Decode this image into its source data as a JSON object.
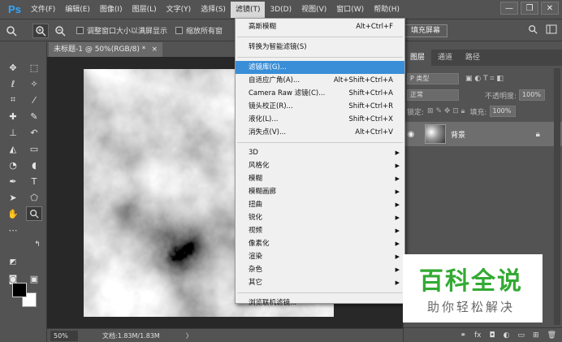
{
  "app": {
    "logo": "Ps"
  },
  "menubar": {
    "items": [
      "文件(F)",
      "编辑(E)",
      "图像(I)",
      "图层(L)",
      "文字(Y)",
      "选择(S)",
      "滤镜(T)",
      "3D(D)",
      "视图(V)",
      "窗口(W)",
      "帮助(H)"
    ],
    "active_index": 6
  },
  "window_controls": {
    "minimize": "—",
    "restore": "❐",
    "close": "✕"
  },
  "options_bar": {
    "checkbox1_label": "调整窗口大小以满屏显示",
    "checkbox2_label": "缩放所有窗",
    "fill_screen_label": "填充屏幕"
  },
  "document_tab": {
    "title": "未标题-1 @ 50%(RGB/8) *",
    "close": "×"
  },
  "status_bar": {
    "zoom": "50%",
    "doc_info": "文档:1.83M/1.83M",
    "arrow": "〉"
  },
  "filter_menu": {
    "items": [
      {
        "label": "高斯模糊",
        "shortcut": "Alt+Ctrl+F",
        "submenu": false,
        "highlight": false,
        "sep_after": true
      },
      {
        "label": "转换为智能滤镜(S)",
        "shortcut": "",
        "submenu": false,
        "highlight": false,
        "sep_after": true
      },
      {
        "label": "滤镜库(G)...",
        "shortcut": "",
        "submenu": false,
        "highlight": true,
        "sep_after": false
      },
      {
        "label": "自适应广角(A)...",
        "shortcut": "Alt+Shift+Ctrl+A",
        "submenu": false,
        "highlight": false,
        "sep_after": false
      },
      {
        "label": "Camera Raw 滤镜(C)...",
        "shortcut": "Shift+Ctrl+A",
        "submenu": false,
        "highlight": false,
        "sep_after": false
      },
      {
        "label": "镜头校正(R)...",
        "shortcut": "Shift+Ctrl+R",
        "submenu": false,
        "highlight": false,
        "sep_after": false
      },
      {
        "label": "液化(L)...",
        "shortcut": "Shift+Ctrl+X",
        "submenu": false,
        "highlight": false,
        "sep_after": false
      },
      {
        "label": "消失点(V)...",
        "shortcut": "Alt+Ctrl+V",
        "submenu": false,
        "highlight": false,
        "sep_after": true
      },
      {
        "label": "3D",
        "shortcut": "",
        "submenu": true,
        "highlight": false,
        "sep_after": false
      },
      {
        "label": "风格化",
        "shortcut": "",
        "submenu": true,
        "highlight": false,
        "sep_after": false
      },
      {
        "label": "模糊",
        "shortcut": "",
        "submenu": true,
        "highlight": false,
        "sep_after": false
      },
      {
        "label": "模糊画廊",
        "shortcut": "",
        "submenu": true,
        "highlight": false,
        "sep_after": false
      },
      {
        "label": "扭曲",
        "shortcut": "",
        "submenu": true,
        "highlight": false,
        "sep_after": false
      },
      {
        "label": "锐化",
        "shortcut": "",
        "submenu": true,
        "highlight": false,
        "sep_after": false
      },
      {
        "label": "视频",
        "shortcut": "",
        "submenu": true,
        "highlight": false,
        "sep_after": false
      },
      {
        "label": "像素化",
        "shortcut": "",
        "submenu": true,
        "highlight": false,
        "sep_after": false
      },
      {
        "label": "渲染",
        "shortcut": "",
        "submenu": true,
        "highlight": false,
        "sep_after": false
      },
      {
        "label": "杂色",
        "shortcut": "",
        "submenu": true,
        "highlight": false,
        "sep_after": false
      },
      {
        "label": "其它",
        "shortcut": "",
        "submenu": true,
        "highlight": false,
        "sep_after": true
      },
      {
        "label": "浏览联机滤镜...",
        "shortcut": "",
        "submenu": false,
        "highlight": false,
        "sep_after": false
      }
    ]
  },
  "layers_panel": {
    "tabs": [
      "图层",
      "通道",
      "路径"
    ],
    "active_tab": 0,
    "kind_filter": "P 类型",
    "blend_mode": "正常",
    "opacity_label": "不透明度:",
    "opacity_value": "100%",
    "lock_label": "锁定:",
    "fill_label": "填充:",
    "fill_value": "100%",
    "layer_name": "背景"
  },
  "watermark": {
    "title": "百科全说",
    "subtitle": "助你轻松解决"
  },
  "colors": {
    "highlight": "#3a8ed8",
    "watermark_green": "#33aa33"
  }
}
